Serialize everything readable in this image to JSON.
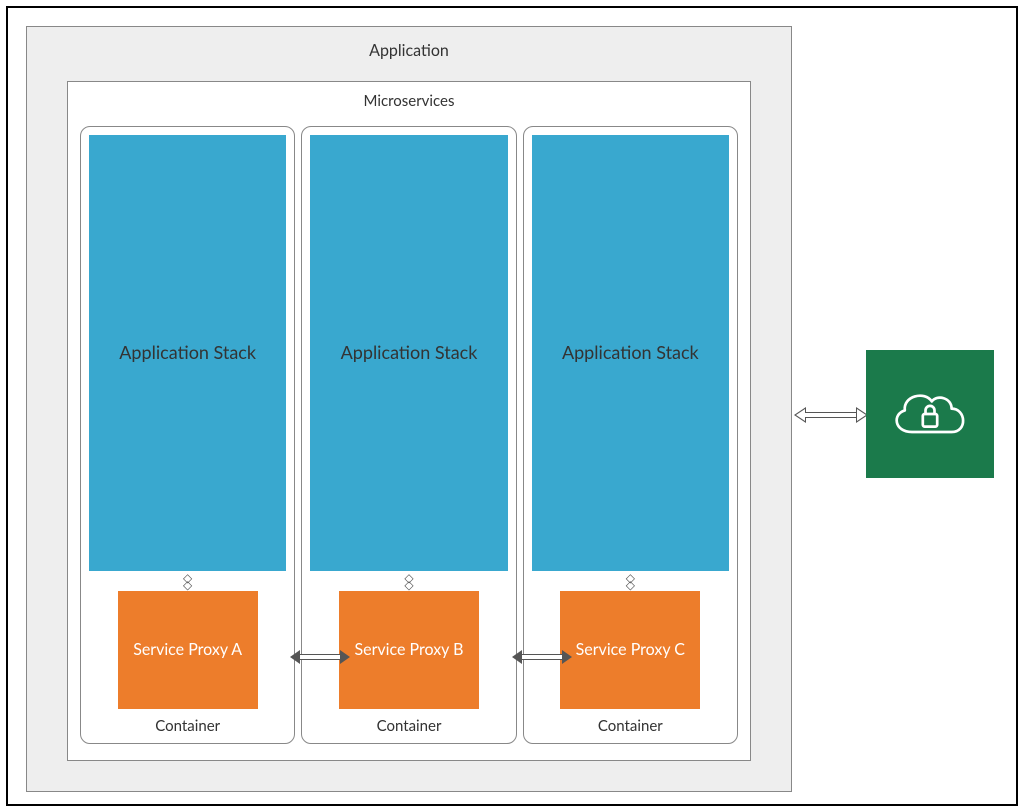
{
  "application": {
    "title": "Application",
    "microservices": {
      "title": "Microservices",
      "containers": [
        {
          "stack_label": "Application Stack",
          "proxy_label": "Service Proxy A",
          "container_label": "Container"
        },
        {
          "stack_label": "Application Stack",
          "proxy_label": "Service Proxy B",
          "container_label": "Container"
        },
        {
          "stack_label": "Application Stack",
          "proxy_label": "Service Proxy C",
          "container_label": "Container"
        }
      ]
    }
  },
  "cloud": {
    "icon_name": "cloud-lock-icon",
    "color": "#1b7a4b"
  },
  "connections": {
    "app_to_cloud": "bidirectional",
    "proxy_a_b": "bidirectional",
    "proxy_b_c": "bidirectional",
    "stack_to_proxy": "bidirectional"
  }
}
